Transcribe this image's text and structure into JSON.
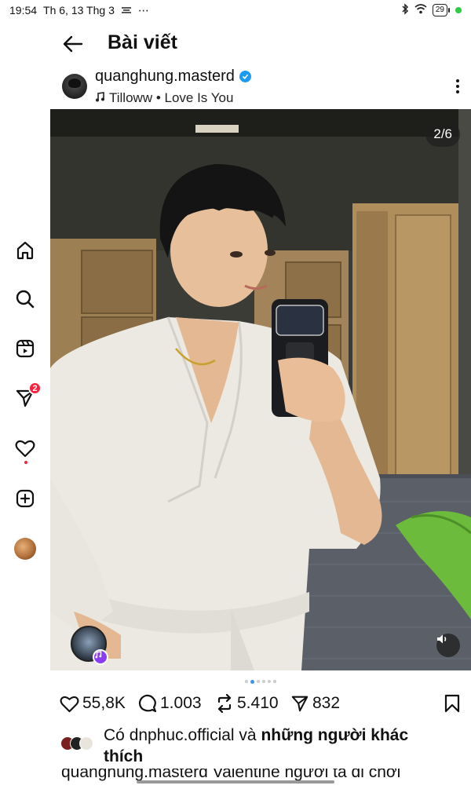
{
  "status_bar": {
    "time": "19:54",
    "date": "Th 6, 13 Thg 3",
    "extra": "⋯",
    "battery": "29",
    "icons": [
      "share-icon",
      "bluetooth-icon",
      "wifi-icon",
      "battery-icon"
    ]
  },
  "header": {
    "title": "Bài viết"
  },
  "post": {
    "author": "quanghung.masterd",
    "music": "Tilloww • Love Is You",
    "counter": "2/6",
    "current_slide": 2,
    "total_slides": 6
  },
  "left_rail": {
    "items": [
      "home-icon",
      "search-icon",
      "reels-icon",
      "direct-messages-icon",
      "notifications-icon",
      "create-icon",
      "profile-avatar"
    ],
    "messages_badge": "2"
  },
  "actions": {
    "likes": "55,8K",
    "comments": "1.003",
    "reposts": "5.410",
    "shares": "832"
  },
  "liked_by": {
    "prefix": "Có",
    "user": "dnphuc.official",
    "connector": "và",
    "others": "những người khác",
    "suffix": "thích"
  },
  "caption": {
    "text": "quanghung.masterd Valentine người ta đi chơi"
  },
  "colors": {
    "accent": "#3897f0",
    "badge": "#ff1f3d",
    "verified": "#1d9bf0",
    "music_badge": "#8c3cf0"
  }
}
